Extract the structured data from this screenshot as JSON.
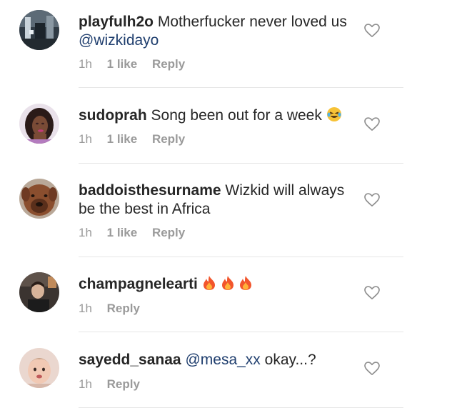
{
  "comments": [
    {
      "username": "playfulh2o",
      "text": "Motherfucker never loved us",
      "mention": "@wizkidayo",
      "time": "1h",
      "likes": "1 like",
      "reply": "Reply"
    },
    {
      "username": "sudoprah",
      "text": "Song been out for a week",
      "emoji": "laughing-crying-face",
      "time": "1h",
      "likes": "1 like",
      "reply": "Reply"
    },
    {
      "username": "baddoisthesurname",
      "text": "Wizkid will always be the best in Africa",
      "time": "1h",
      "likes": "1 like",
      "reply": "Reply"
    },
    {
      "username": "champagnelearti",
      "emoji": "fire x3",
      "time": "1h",
      "reply": "Reply"
    },
    {
      "username": "sayedd_sanaa",
      "mention": "@mesa_xx",
      "text": "okay...?",
      "time": "1h",
      "reply": "Reply"
    }
  ],
  "colors": {
    "text": "#262626",
    "meta": "#9a9a9a",
    "mention": "#1f3e6e",
    "divider": "#e6e6e6"
  }
}
